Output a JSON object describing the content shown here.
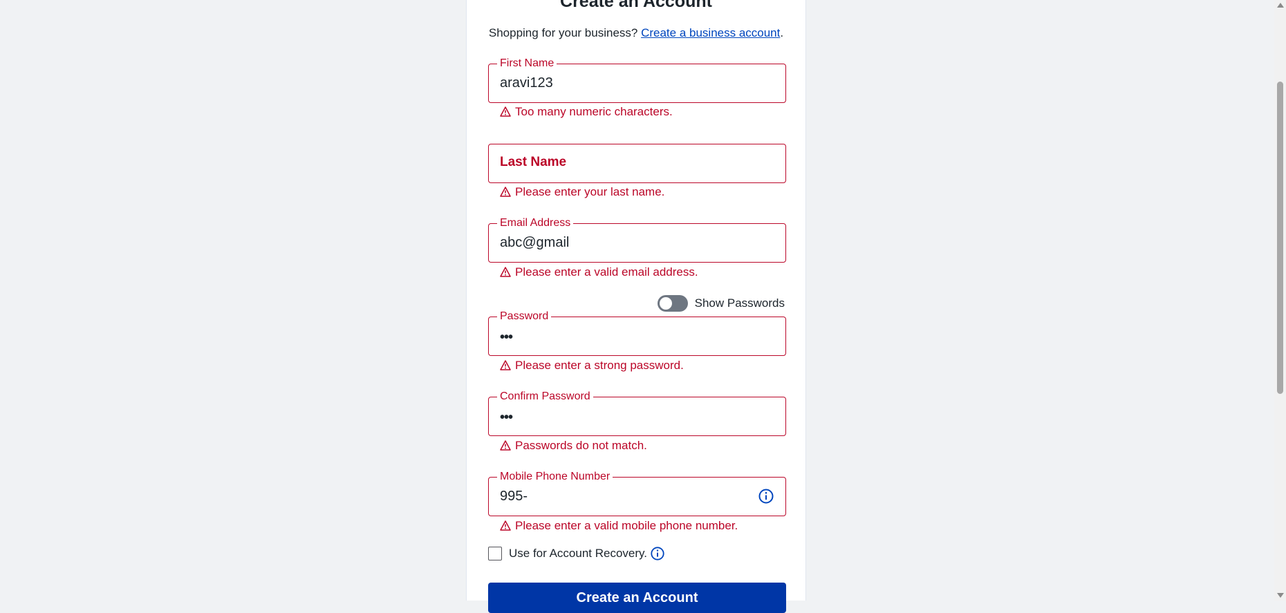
{
  "page": {
    "title": "Create an Account",
    "subtitle_prefix": "Shopping for your business? ",
    "subtitle_link": "Create a business account",
    "subtitle_suffix": "."
  },
  "fields": {
    "first_name": {
      "label": "First Name",
      "value": "aravi123",
      "error": "Too many numeric characters."
    },
    "last_name": {
      "label": "Last Name",
      "value": "",
      "error": "Please enter your last name."
    },
    "email": {
      "label": "Email Address",
      "value": "abc@gmail",
      "error": "Please enter a valid email address."
    },
    "password": {
      "label": "Password",
      "value": "•••",
      "error": "Please enter a strong password."
    },
    "confirm_password": {
      "label": "Confirm Password",
      "value": "•••",
      "error": "Passwords do not match."
    },
    "phone": {
      "label": "Mobile Phone Number",
      "value": "995-",
      "error": "Please enter a valid mobile phone number."
    }
  },
  "toggle": {
    "label": "Show Passwords",
    "on": false
  },
  "recovery": {
    "label": "Use for Account Recovery.",
    "checked": false
  },
  "submit": {
    "label": "Create an Account"
  },
  "colors": {
    "error": "#bb0628",
    "primary": "#0036a6",
    "link": "#0046be"
  }
}
